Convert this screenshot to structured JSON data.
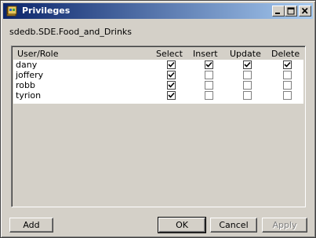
{
  "window": {
    "title": "Privileges"
  },
  "dataset_path": "sdedb.SDE.Food_and_Drinks",
  "grid": {
    "columns": [
      "User/Role",
      "Select",
      "Insert",
      "Update",
      "Delete"
    ],
    "rows": [
      {
        "name": "dany",
        "select": true,
        "insert": true,
        "update": true,
        "delete": true
      },
      {
        "name": "joffery",
        "select": true,
        "insert": false,
        "update": false,
        "delete": false
      },
      {
        "name": "robb",
        "select": true,
        "insert": false,
        "update": false,
        "delete": false
      },
      {
        "name": "tyrion",
        "select": true,
        "insert": false,
        "update": false,
        "delete": false
      }
    ]
  },
  "buttons": {
    "add": "Add",
    "ok": "OK",
    "cancel": "Cancel",
    "apply": "Apply"
  },
  "icons": {
    "app": "catalog-icon",
    "minimize": "minimize-icon",
    "maximize": "maximize-icon",
    "close": "close-icon"
  }
}
